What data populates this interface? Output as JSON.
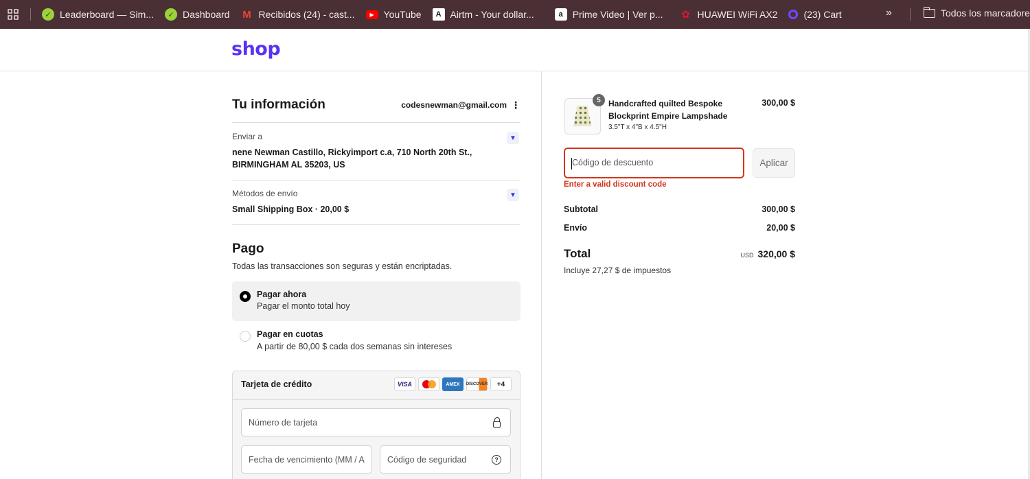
{
  "bookmarks": {
    "items": [
      {
        "label": "Leaderboard — Sim...",
        "icon": "leaf-check-icon"
      },
      {
        "label": "Dashboard",
        "icon": "leaf-check-icon"
      },
      {
        "label": "Recibidos (24) - cast...",
        "icon": "gmail-icon"
      },
      {
        "label": "YouTube",
        "icon": "youtube-icon"
      },
      {
        "label": "Airtm - Your dollar...",
        "icon": "airtm-icon"
      },
      {
        "label": "Prime Video | Ver p...",
        "icon": "amazon-icon"
      },
      {
        "label": "HUAWEI WiFi AX2",
        "icon": "huawei-icon"
      },
      {
        "label": "(23) Cart",
        "icon": "cart-ring-icon"
      }
    ],
    "more": "»",
    "folder_label": "Todos los marcadores"
  },
  "header": {
    "logo": "shop"
  },
  "info": {
    "title": "Tu información",
    "email": "codesnewman@gmail.com",
    "ship_to_label": "Enviar a",
    "ship_to_value": "nene Newman Castillo, Rickyimport c.a, 710 North 20th St., BIRMINGHAM AL 35203, US",
    "shipping_method_label": "Métodos de envío",
    "shipping_method_value": "Small Shipping Box · 20,00 $"
  },
  "payment": {
    "title": "Pago",
    "subtitle": "Todas las transacciones son seguras y están encriptadas.",
    "options": [
      {
        "title": "Pagar ahora",
        "subtitle": "Pagar el monto total hoy",
        "selected": true
      },
      {
        "title": "Pagar en cuotas",
        "subtitle": "A partir de 80,00 $ cada dos semanas sin intereses",
        "selected": false
      }
    ],
    "card_section_title": "Tarjeta de crédito",
    "card_brands": [
      "VISA",
      "",
      "AMEX",
      "DISCOVER",
      "+4"
    ],
    "card_number_placeholder": "Número de tarjeta",
    "expiry_placeholder": "Fecha de vencimiento (MM / A",
    "cvv_placeholder": "Código de seguridad"
  },
  "summary": {
    "product": {
      "quantity": "5",
      "name": "Handcrafted quilted Bespoke Blockprint Empire Lampshade",
      "variant": "3.5\"T x 4\"B x 4.5\"H",
      "price": "300,00 $"
    },
    "discount_placeholder": "Código de descuento",
    "apply_label": "Aplicar",
    "discount_error": "Enter a valid discount code",
    "subtotal_label": "Subtotal",
    "subtotal_value": "300,00 $",
    "shipping_label": "Envío",
    "shipping_value": "20,00 $",
    "total_label": "Total",
    "currency": "USD",
    "total_value": "320,00 $",
    "taxes_note": "Incluye 27,27 $ de impuestos"
  },
  "colors": {
    "brand": "#5a31f4",
    "bookmarks_bg": "#4a2f35",
    "error": "#d1361e"
  }
}
